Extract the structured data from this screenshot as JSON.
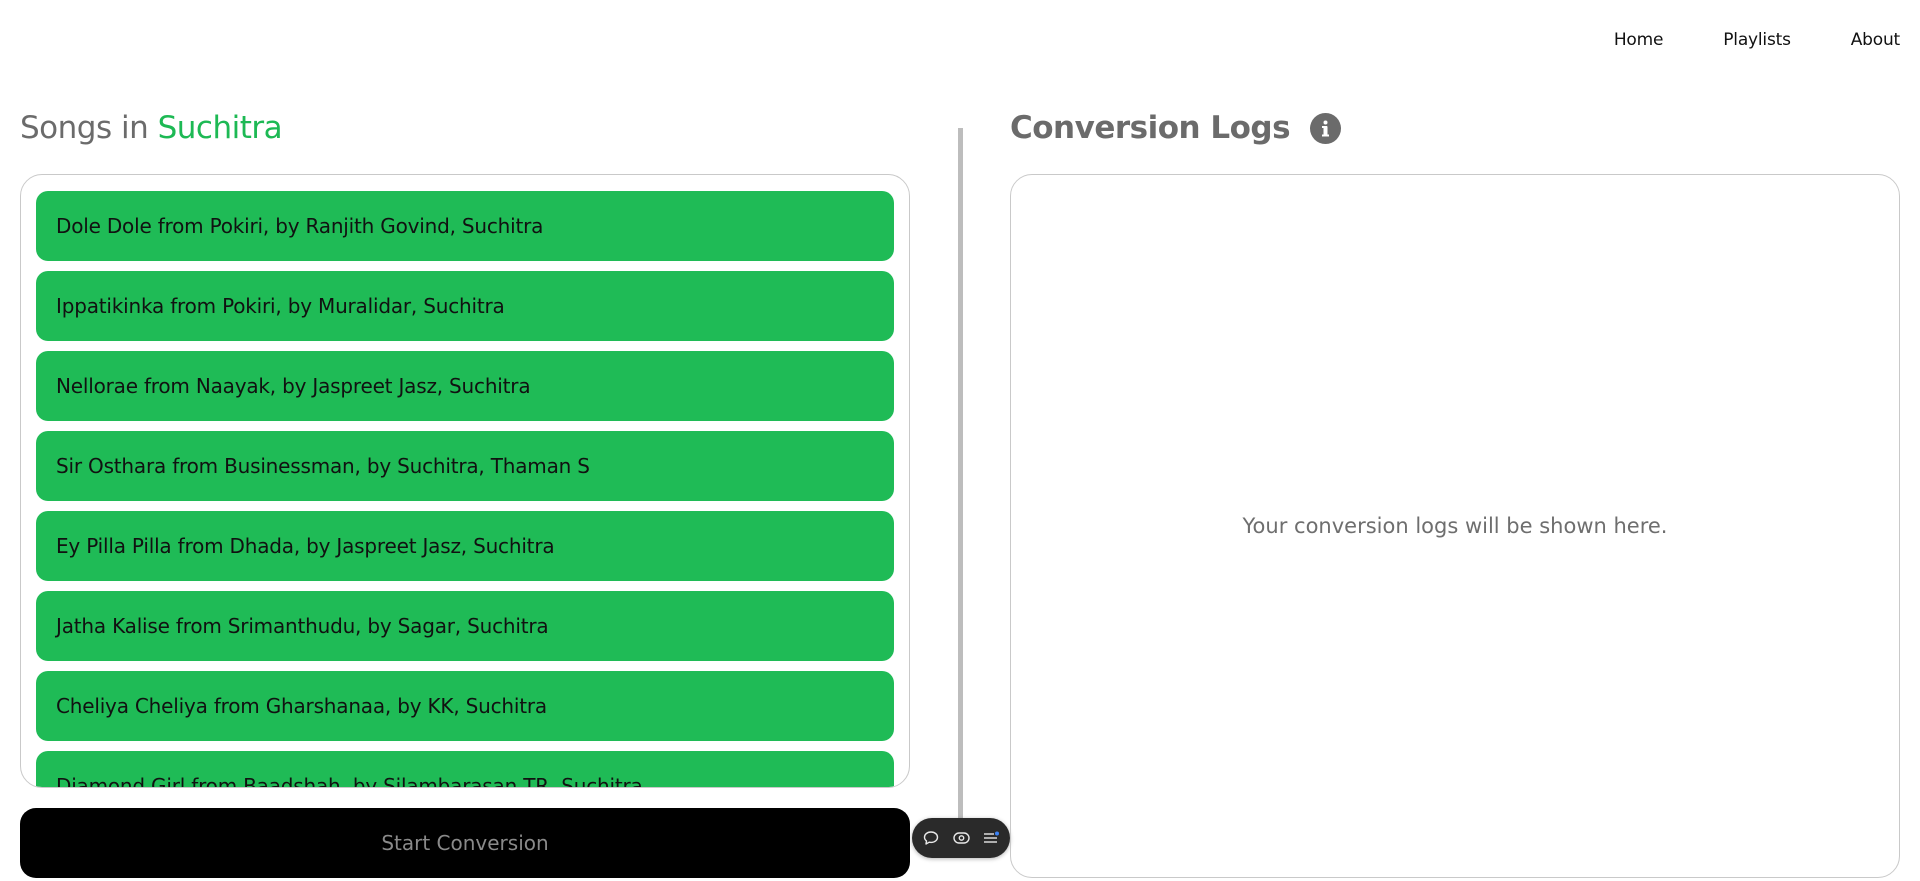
{
  "nav": {
    "items": [
      {
        "label": "Home"
      },
      {
        "label": "Playlists"
      },
      {
        "label": "About"
      }
    ]
  },
  "songs_panel": {
    "title_prefix": "Songs in ",
    "title_accent": "Suchitra",
    "songs": [
      {
        "label": "Dole Dole from Pokiri, by Ranjith Govind, Suchitra"
      },
      {
        "label": "Ippatikinka from Pokiri, by Muralidar, Suchitra"
      },
      {
        "label": "Nellorae from Naayak, by Jaspreet Jasz, Suchitra"
      },
      {
        "label": "Sir Osthara from Businessman, by Suchitra, Thaman S"
      },
      {
        "label": "Ey Pilla Pilla from Dhada, by Jaspreet Jasz, Suchitra"
      },
      {
        "label": "Jatha Kalise from Srimanthudu, by Sagar, Suchitra"
      },
      {
        "label": "Cheliya Cheliya from Gharshanaa, by KK, Suchitra"
      },
      {
        "label": "Diamond Girl from Baadshah, by Silambarasan TR, Suchitra"
      }
    ],
    "start_button": "Start Conversion"
  },
  "logs_panel": {
    "title": "Conversion Logs",
    "placeholder": "Your conversion logs will be shown here."
  },
  "colors": {
    "accent": "#1fbb56",
    "title_gray": "#6b6b6b",
    "button_bg": "#000000"
  },
  "floating_toolbar": {
    "icons": [
      "chat-bubble-icon",
      "eye-icon",
      "list-icon"
    ]
  }
}
